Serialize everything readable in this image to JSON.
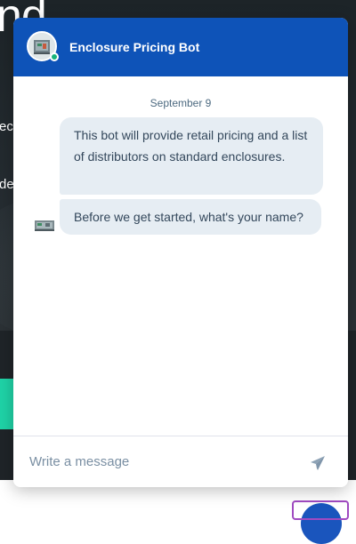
{
  "background_page": {
    "hero_word": "nd",
    "fragment_1": "ec",
    "fragment_2": "de"
  },
  "chat": {
    "header": {
      "bot_name": "Enclosure Pricing Bot",
      "status": "online",
      "avatar_icon": "enclosure-thumbnail-icon"
    },
    "date_label": "September 9",
    "messages": [
      {
        "sender": "bot",
        "text": "This bot will provide retail pricing and a list of distributors on standard enclosures."
      },
      {
        "sender": "bot",
        "text": "Before we get started, what's your name?"
      }
    ],
    "composer": {
      "placeholder": "Write a message",
      "value": "",
      "send_icon": "paper-plane-icon"
    }
  },
  "colors": {
    "header": "#0e53b8",
    "bubble": "#e6edf3",
    "online_dot": "#18b37a",
    "page_background": "#1f2428",
    "accent_green": "#1fd3a7",
    "launcher": "#1a55bd",
    "focus_outline": "#a04ac1"
  }
}
